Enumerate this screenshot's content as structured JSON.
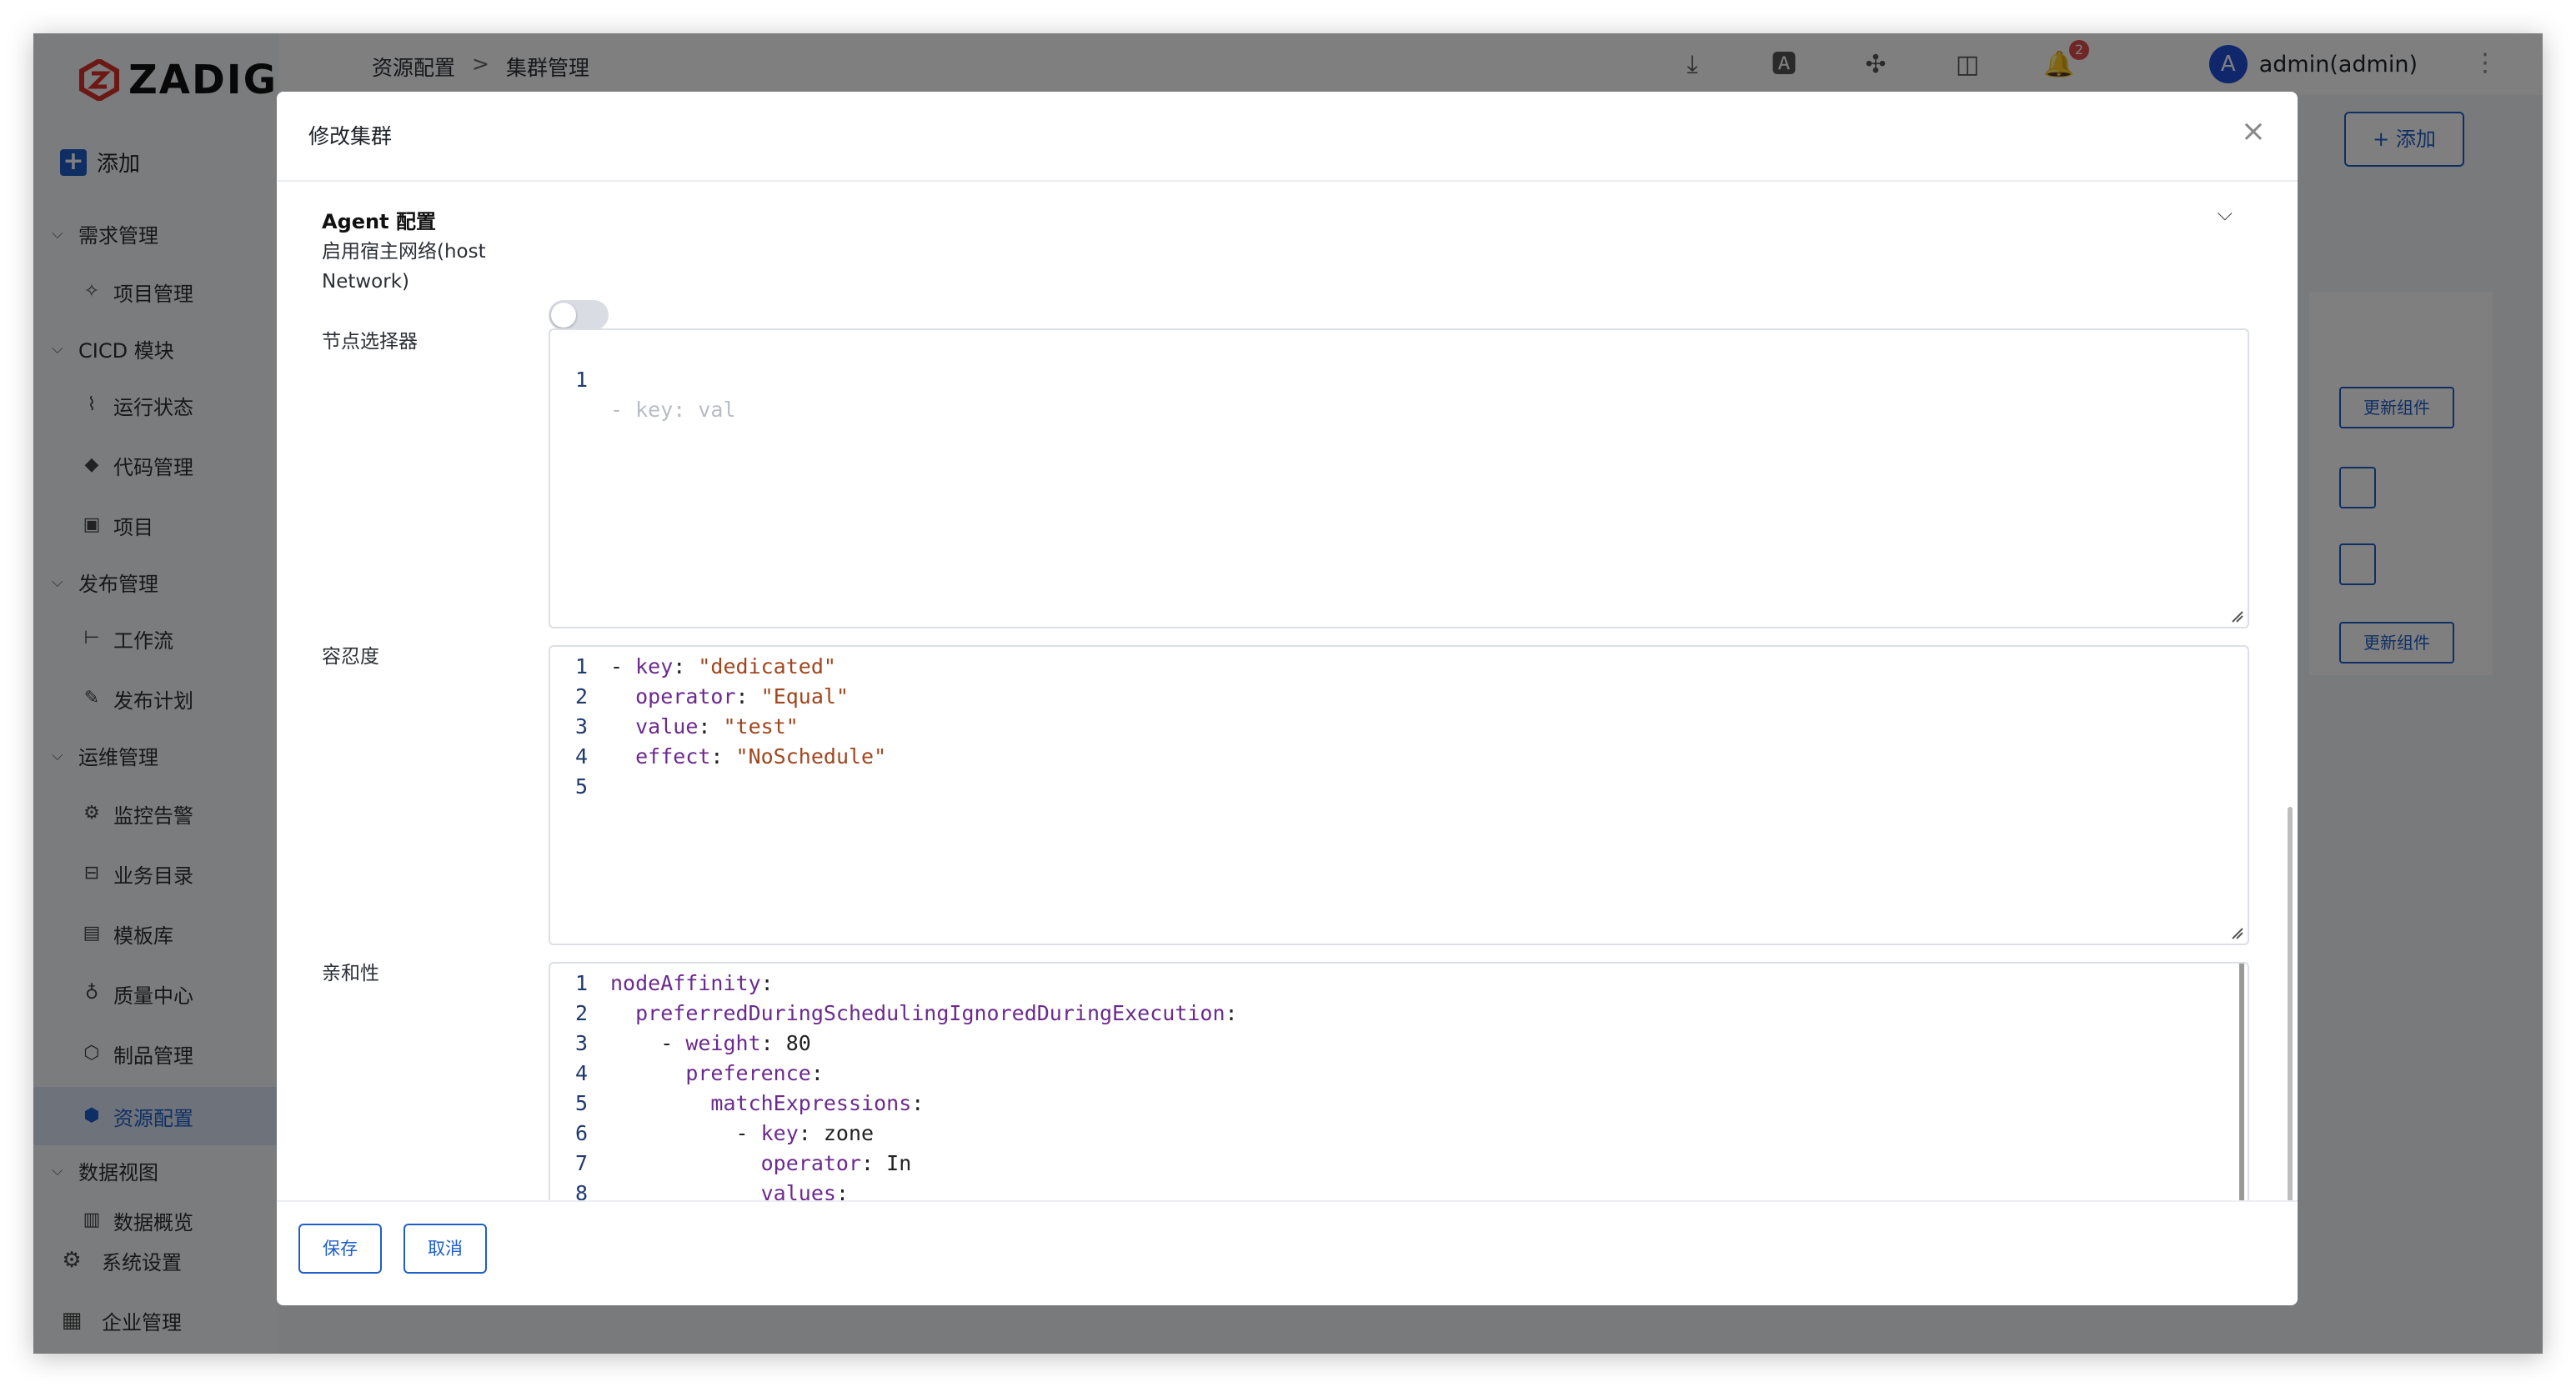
{
  "app": {
    "logo_text": "ZADIG",
    "add_label": "添加"
  },
  "sidebar": {
    "groups": [
      {
        "label": "需求管理"
      },
      {
        "label": "CICD 模块"
      },
      {
        "label": "发布管理"
      },
      {
        "label": "运维管理"
      },
      {
        "label": "数据视图"
      }
    ],
    "items": [
      {
        "label": "项目管理",
        "icon": "idea-icon"
      },
      {
        "label": "运行状态",
        "icon": "pulse-icon"
      },
      {
        "label": "代码管理",
        "icon": "gitlab-icon"
      },
      {
        "label": "项目",
        "icon": "project-icon"
      },
      {
        "label": "工作流",
        "icon": "workflow-icon"
      },
      {
        "label": "发布计划",
        "icon": "plan-icon"
      },
      {
        "label": "监控告警",
        "icon": "monitor-icon"
      },
      {
        "label": "业务目录",
        "icon": "catalog-icon"
      },
      {
        "label": "模板库",
        "icon": "template-icon"
      },
      {
        "label": "质量中心",
        "icon": "quality-icon"
      },
      {
        "label": "制品管理",
        "icon": "artifact-icon"
      },
      {
        "label": "资源配置",
        "icon": "cube-icon",
        "active": true
      },
      {
        "label": "数据概览",
        "icon": "chart-icon"
      }
    ],
    "bottom": [
      {
        "label": "系统设置",
        "icon": "gear-icon"
      },
      {
        "label": "企业管理",
        "icon": "building-icon"
      }
    ]
  },
  "topbar": {
    "breadcrumb": [
      "资源配置",
      ">",
      "集群管理"
    ],
    "notification_count": "2",
    "user_initial": "A",
    "user_name": "admin(admin)"
  },
  "content": {
    "add_button": "+ 添加",
    "row_buttons": [
      "更新组件",
      "更新组件"
    ]
  },
  "modal": {
    "title": "修改集群",
    "close": "×",
    "section_title": "Agent 配置",
    "fields": {
      "host_network_label_1": "启用宿主网络(host",
      "host_network_label_2": "Network)",
      "host_network_enabled": false,
      "node_selector_label": "节点选择器",
      "node_selector_placeholder": "- key: val",
      "tolerations_label": "容忍度",
      "affinity_label": "亲和性"
    },
    "tolerations_lines": [
      {
        "n": "1",
        "t": [
          [
            "p",
            "- "
          ],
          [
            "k",
            "key"
          ],
          [
            "p",
            ": "
          ],
          [
            "s",
            "\"dedicated\""
          ]
        ]
      },
      {
        "n": "2",
        "t": [
          [
            "p",
            "  "
          ],
          [
            "k",
            "operator"
          ],
          [
            "p",
            ": "
          ],
          [
            "s",
            "\"Equal\""
          ]
        ]
      },
      {
        "n": "3",
        "t": [
          [
            "p",
            "  "
          ],
          [
            "k",
            "value"
          ],
          [
            "p",
            ": "
          ],
          [
            "s",
            "\"test\""
          ]
        ]
      },
      {
        "n": "4",
        "t": [
          [
            "p",
            "  "
          ],
          [
            "k",
            "effect"
          ],
          [
            "p",
            ": "
          ],
          [
            "s",
            "\"NoSchedule\""
          ]
        ]
      },
      {
        "n": "5",
        "t": []
      }
    ],
    "affinity_lines": [
      {
        "n": "1",
        "t": [
          [
            "k",
            "nodeAffinity"
          ],
          [
            "p",
            ":"
          ]
        ]
      },
      {
        "n": "2",
        "t": [
          [
            "p",
            "  "
          ],
          [
            "k",
            "preferredDuringSchedulingIgnoredDuringExecution"
          ],
          [
            "p",
            ":"
          ]
        ]
      },
      {
        "n": "3",
        "t": [
          [
            "p",
            "    - "
          ],
          [
            "k",
            "weight"
          ],
          [
            "p",
            ": 80"
          ]
        ]
      },
      {
        "n": "4",
        "t": [
          [
            "p",
            "      "
          ],
          [
            "k",
            "preference"
          ],
          [
            "p",
            ":"
          ]
        ]
      },
      {
        "n": "5",
        "t": [
          [
            "p",
            "        "
          ],
          [
            "k",
            "matchExpressions"
          ],
          [
            "p",
            ":"
          ]
        ]
      },
      {
        "n": "6",
        "t": [
          [
            "p",
            "          - "
          ],
          [
            "k",
            "key"
          ],
          [
            "p",
            ": zone"
          ]
        ]
      },
      {
        "n": "7",
        "t": [
          [
            "p",
            "            "
          ],
          [
            "k",
            "operator"
          ],
          [
            "p",
            ": In"
          ]
        ]
      },
      {
        "n": "8",
        "t": [
          [
            "p",
            "            "
          ],
          [
            "k",
            "values"
          ],
          [
            "p",
            ":"
          ]
        ]
      }
    ],
    "save_label": "保存",
    "cancel_label": "取消"
  }
}
